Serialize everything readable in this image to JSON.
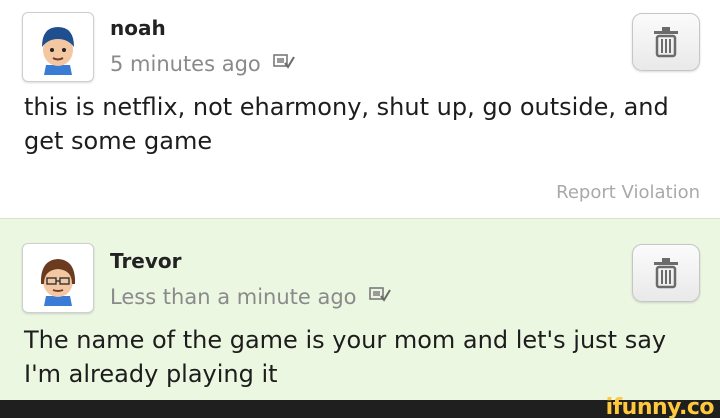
{
  "posts": [
    {
      "username": "noah",
      "timestamp": "5 minutes ago",
      "text": "this is netflix, not eharmony, shut up, go outside, and get some game",
      "report_label": "Report Violation"
    },
    {
      "username": "Trevor",
      "timestamp": "Less than a minute ago",
      "text": "The name of the game is your mom and let's just say I'm already playing it"
    }
  ],
  "watermark": "ifunny.co",
  "colors": {
    "highlight_bg": "#ecf7e2",
    "meta_text": "#8a8a8a",
    "watermark": "#ffc83d"
  }
}
